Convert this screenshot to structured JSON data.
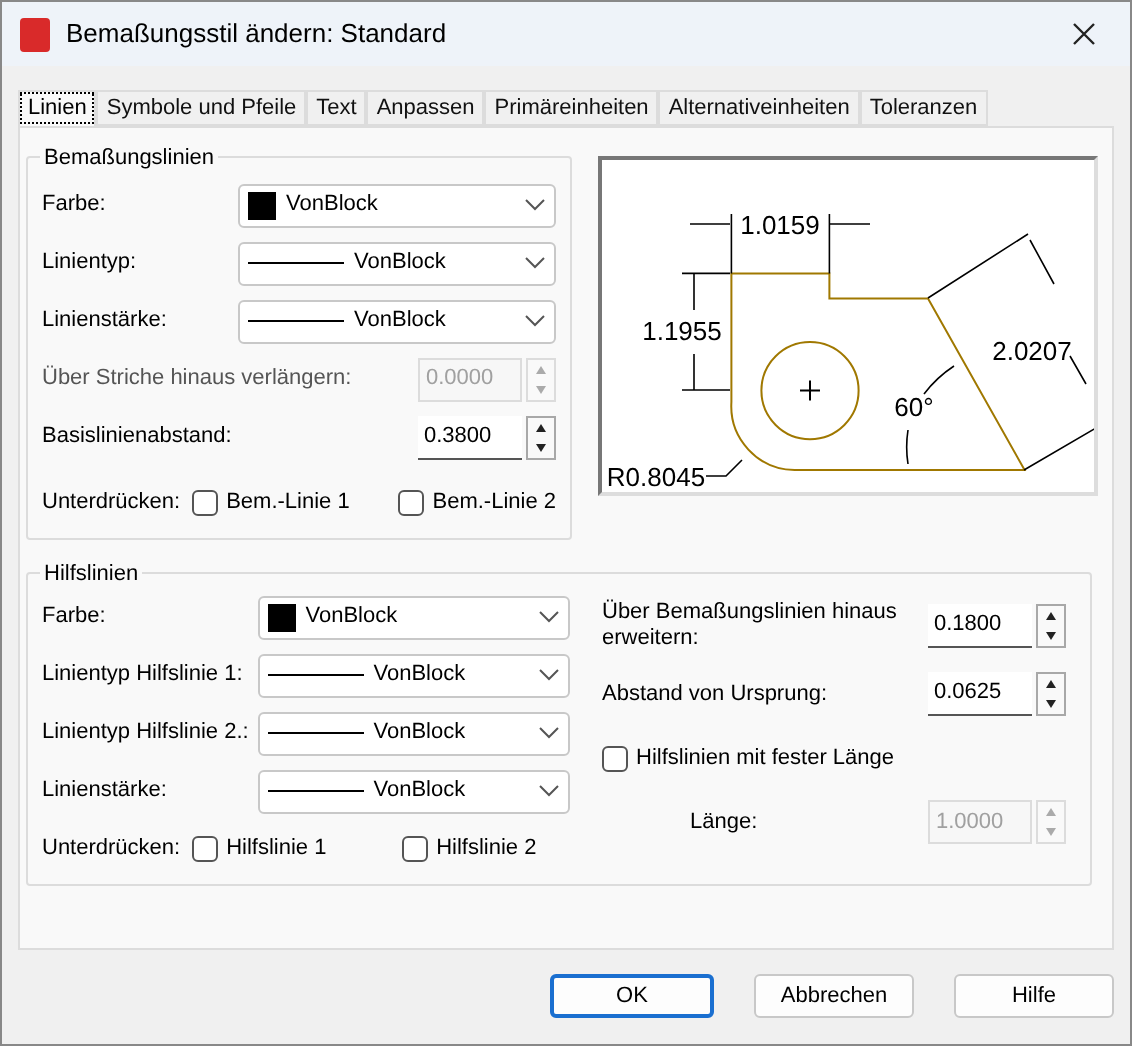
{
  "window": {
    "title": "Bemaßungsstil ändern: Standard"
  },
  "tabs": [
    {
      "label": "Linien",
      "selected": true
    },
    {
      "label": "Symbole und Pfeile",
      "selected": false
    },
    {
      "label": "Text",
      "selected": false
    },
    {
      "label": "Anpassen",
      "selected": false
    },
    {
      "label": "Primäreinheiten",
      "selected": false
    },
    {
      "label": "Alternativeinheiten",
      "selected": false
    },
    {
      "label": "Toleranzen",
      "selected": false
    }
  ],
  "dimension_lines": {
    "title": "Bemaßungslinien",
    "rows": [
      {
        "kind": "color_combo",
        "label": "Farbe:",
        "value": "VonBlock"
      },
      {
        "kind": "line_combo",
        "label": "Linientyp:",
        "value": "VonBlock"
      },
      {
        "kind": "line_combo",
        "label": "Linienstärke:",
        "value": "VonBlock"
      },
      {
        "kind": "spin",
        "label": "Über Striche hinaus verlängern:",
        "value": "0.0000",
        "disabled": true
      },
      {
        "kind": "spin",
        "label": "Basislinienabstand:",
        "value": "0.3800",
        "disabled": false
      },
      {
        "kind": "checks",
        "label": "Unterdrücken:",
        "options": [
          {
            "label": "Bem.-Linie 1",
            "checked": false
          },
          {
            "label": "Bem.-Linie 2",
            "checked": false
          }
        ]
      }
    ]
  },
  "preview": {
    "labels": [
      "1.0159",
      "1.1955",
      "2.0207",
      "60°",
      "R0.8045"
    ]
  },
  "extension_lines": {
    "title": "Hilfslinien",
    "rows": [
      {
        "kind": "color_combo",
        "label": "Farbe:",
        "value": "VonBlock"
      },
      {
        "kind": "line_combo",
        "label": "Linientyp Hilfslinie 1:",
        "value": "VonBlock"
      },
      {
        "kind": "line_combo",
        "label": "Linientyp Hilfslinie 2.:",
        "value": "VonBlock"
      },
      {
        "kind": "line_combo",
        "label": "Linienstärke:",
        "value": "VonBlock"
      },
      {
        "kind": "checks",
        "label": "Unterdrücken:",
        "options": [
          {
            "label": "Hilfslinie 1",
            "checked": false
          },
          {
            "label": "Hilfslinie 2",
            "checked": false
          }
        ]
      }
    ],
    "right_rows": [
      {
        "kind": "spin",
        "label": "Über Bemaßungslinien hinaus erweitern:",
        "value": "0.1800",
        "disabled": false
      },
      {
        "kind": "spin",
        "label": "Abstand von Ursprung:",
        "value": "0.0625",
        "disabled": false
      },
      {
        "kind": "check",
        "label": "Hilfslinien mit fester Länge",
        "checked": false
      },
      {
        "kind": "sub_spin",
        "label": "Länge:",
        "value": "1.0000",
        "disabled": true
      }
    ]
  },
  "buttons": [
    {
      "label": "OK",
      "default": true
    },
    {
      "label": "Abbrechen",
      "default": false
    },
    {
      "label": "Hilfe",
      "default": false
    }
  ]
}
